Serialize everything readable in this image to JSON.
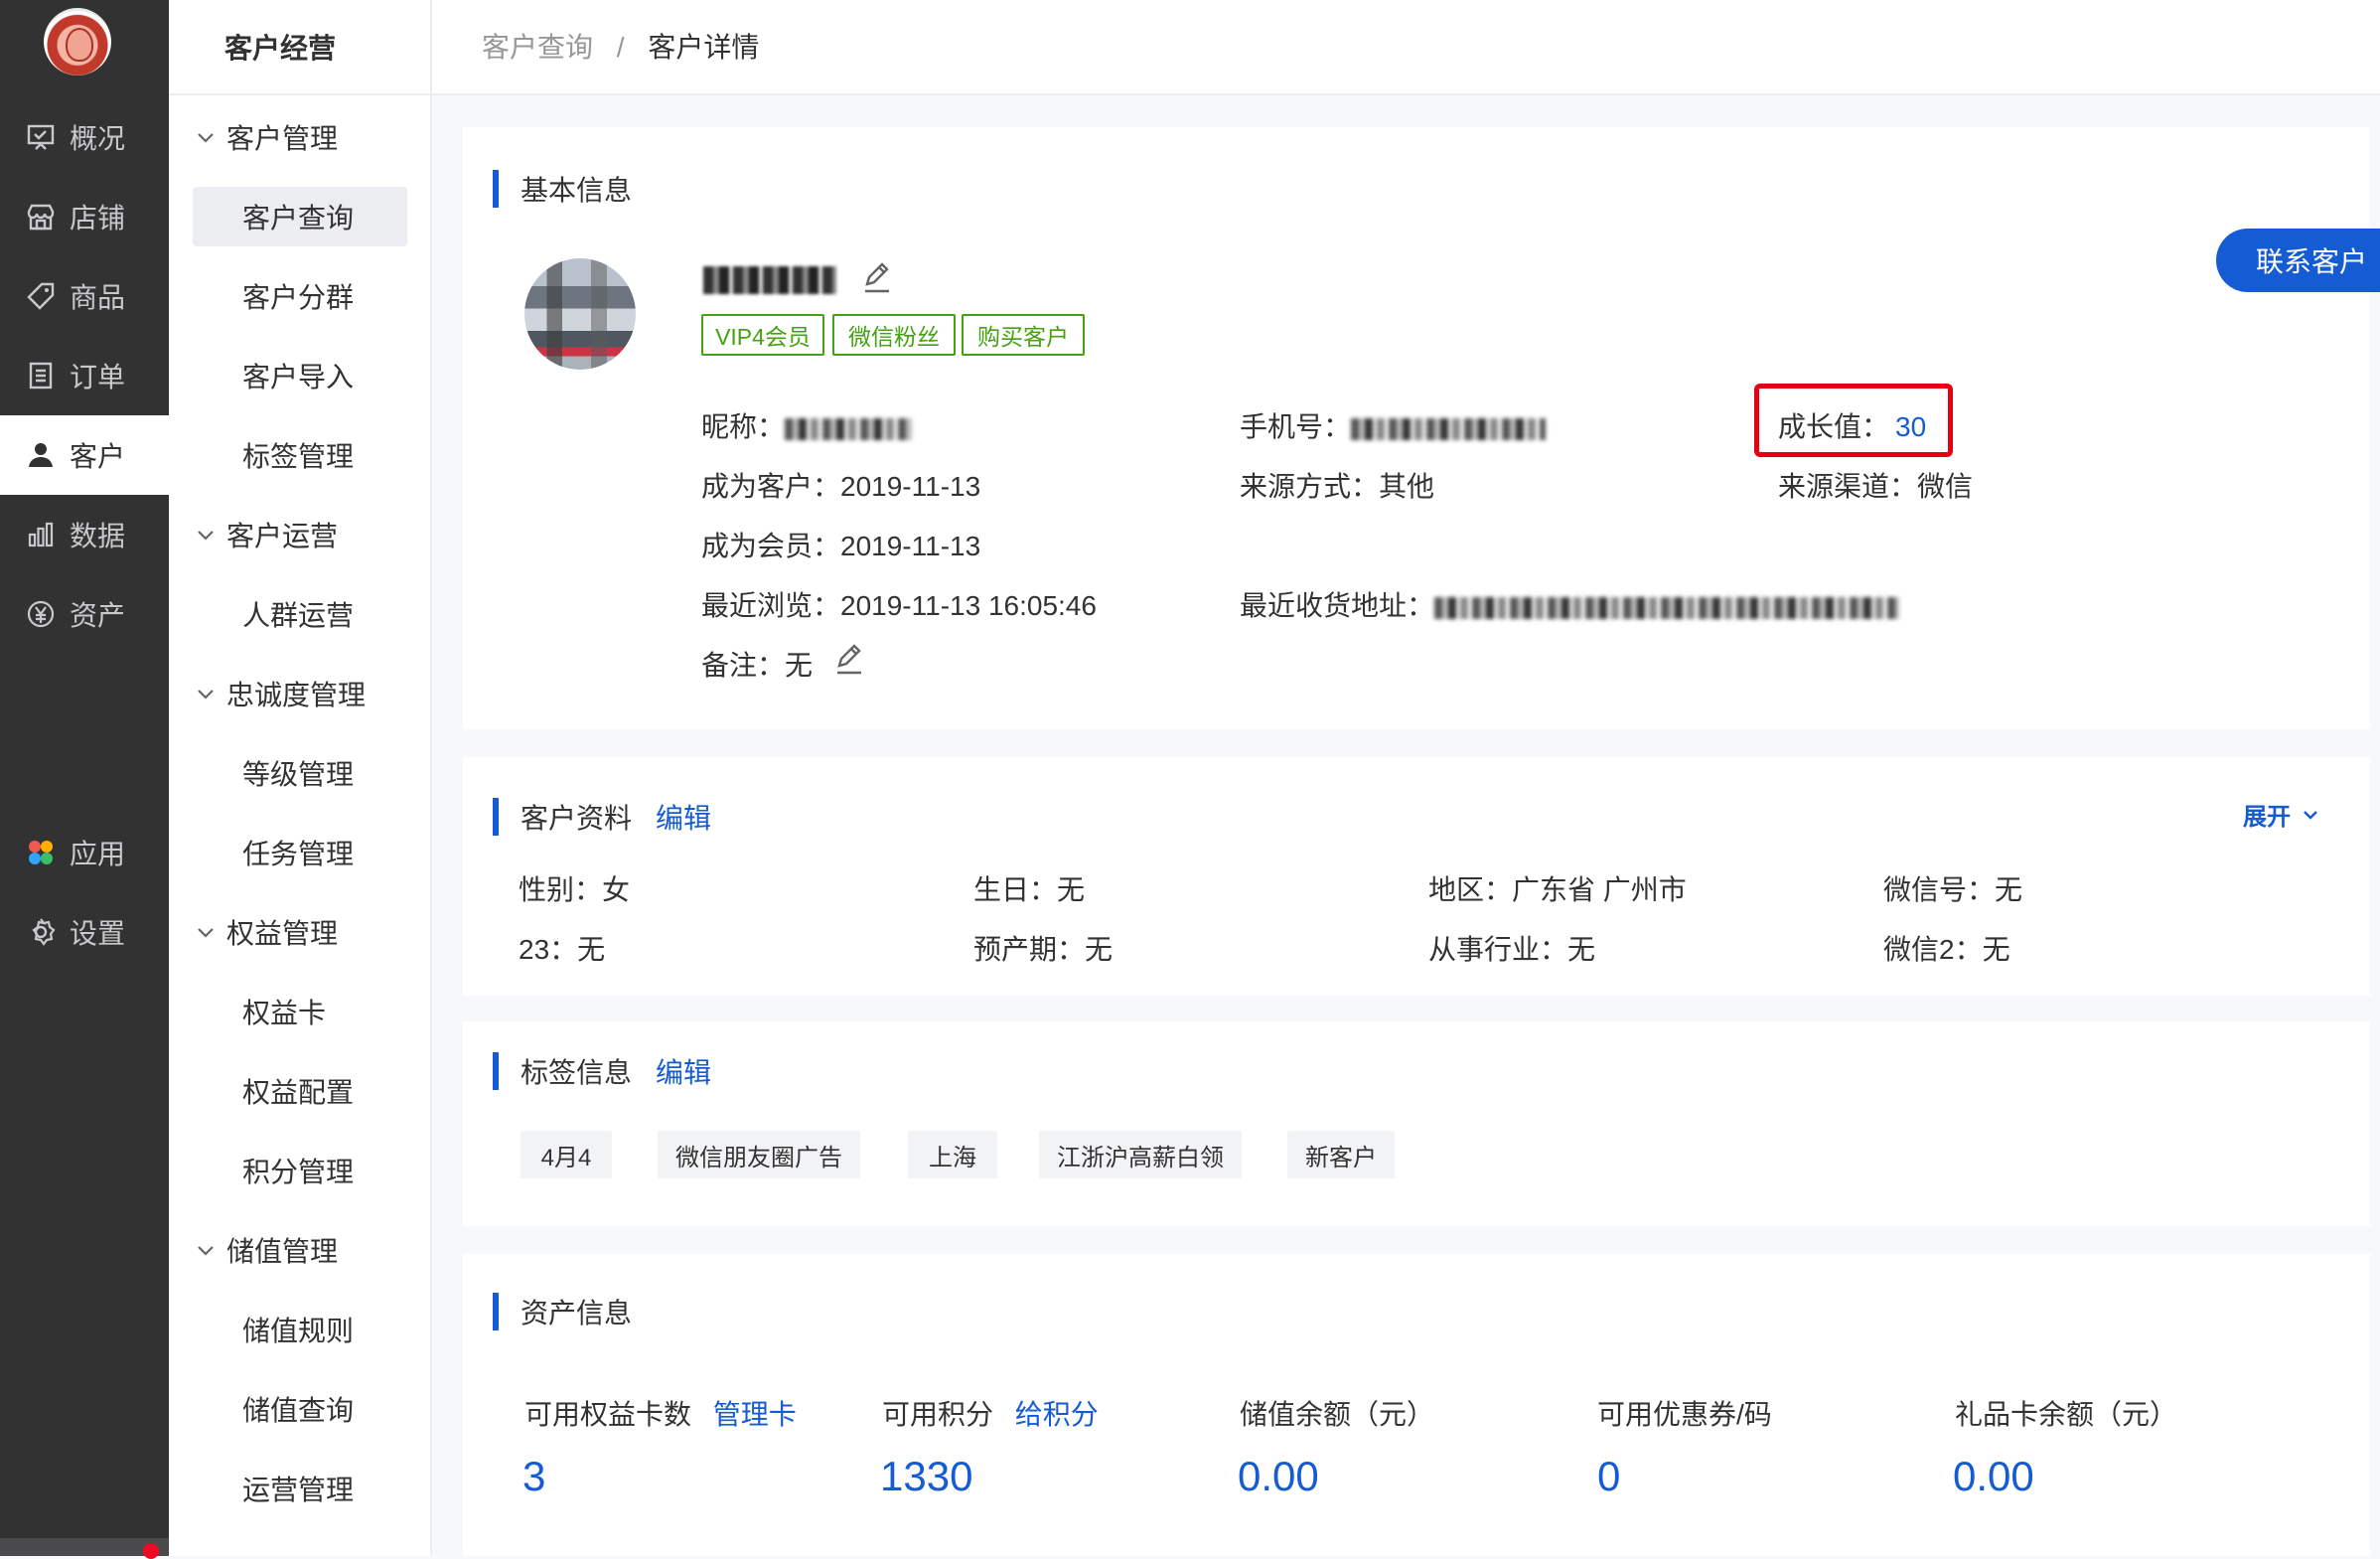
{
  "nav": {
    "items": [
      {
        "label": "概况",
        "icon": "overview-icon"
      },
      {
        "label": "店铺",
        "icon": "store-icon"
      },
      {
        "label": "商品",
        "icon": "tag-icon"
      },
      {
        "label": "订单",
        "icon": "order-icon"
      },
      {
        "label": "客户",
        "icon": "user-icon",
        "active": true
      },
      {
        "label": "数据",
        "icon": "chart-icon"
      },
      {
        "label": "资产",
        "icon": "yuan-icon"
      },
      {
        "label": "应用",
        "icon": "apps-icon"
      },
      {
        "label": "设置",
        "icon": "settings-icon"
      }
    ]
  },
  "submenu": {
    "title": "客户经营",
    "groups": [
      {
        "label": "客户管理",
        "items": [
          "客户查询",
          "客户分群",
          "客户导入",
          "标签管理"
        ]
      },
      {
        "label": "客户运营",
        "items": [
          "人群运营"
        ]
      },
      {
        "label": "忠诚度管理",
        "items": [
          "等级管理",
          "任务管理"
        ]
      },
      {
        "label": "权益管理",
        "items": [
          "权益卡",
          "权益配置",
          "积分管理"
        ]
      },
      {
        "label": "储值管理",
        "items": [
          "储值规则",
          "储值查询",
          "运营管理"
        ]
      }
    ]
  },
  "breadcrumb": {
    "parent": "客户查询",
    "separator": "/",
    "current": "客户详情"
  },
  "basic": {
    "title": "基本信息",
    "tags": [
      "VIP4会员",
      "微信粉丝",
      "购买客户"
    ],
    "nickname_label": "昵称：",
    "phone_label": "手机号：",
    "growth_label": "成长值：",
    "growth_value": "30",
    "became_customer_label": "成为客户：",
    "became_customer_value": "2019-11-13",
    "source_method_label": "来源方式：",
    "source_method_value": "其他",
    "source_channel_label": "来源渠道：",
    "source_channel_value": "微信",
    "became_member_label": "成为会员：",
    "became_member_value": "2019-11-13",
    "last_visit_label": "最近浏览：",
    "last_visit_value": "2019-11-13 16:05:46",
    "address_label": "最近收货地址：",
    "remark_label": "备注：",
    "remark_value": "无",
    "contact_button": "联系客户"
  },
  "profile": {
    "title": "客户资料",
    "edit": "编辑",
    "expand": "展开",
    "fields": [
      {
        "label": "性别：",
        "value": "女"
      },
      {
        "label": "生日：",
        "value": "无"
      },
      {
        "label": "地区：",
        "value": "广东省 广州市"
      },
      {
        "label": "微信号：",
        "value": "无"
      },
      {
        "label": "23：",
        "value": "无"
      },
      {
        "label": "预产期：",
        "value": "无"
      },
      {
        "label": "从事行业：",
        "value": "无"
      },
      {
        "label": "微信2：",
        "value": "无"
      }
    ]
  },
  "tags": {
    "title": "标签信息",
    "edit": "编辑",
    "chips": [
      "4月4",
      "微信朋友圈广告",
      "上海",
      "江浙沪高薪白领",
      "新客户"
    ]
  },
  "assets": {
    "title": "资产信息",
    "items": [
      {
        "label": "可用权益卡数",
        "link": "管理卡",
        "value": "3"
      },
      {
        "label": "可用积分",
        "link": "给积分",
        "value": "1330"
      },
      {
        "label": "储值余额（元）",
        "link": "",
        "value": "0.00"
      },
      {
        "label": "可用优惠券/码",
        "link": "",
        "value": "0"
      },
      {
        "label": "礼品卡余额（元）",
        "link": "",
        "value": "0.00"
      }
    ]
  }
}
